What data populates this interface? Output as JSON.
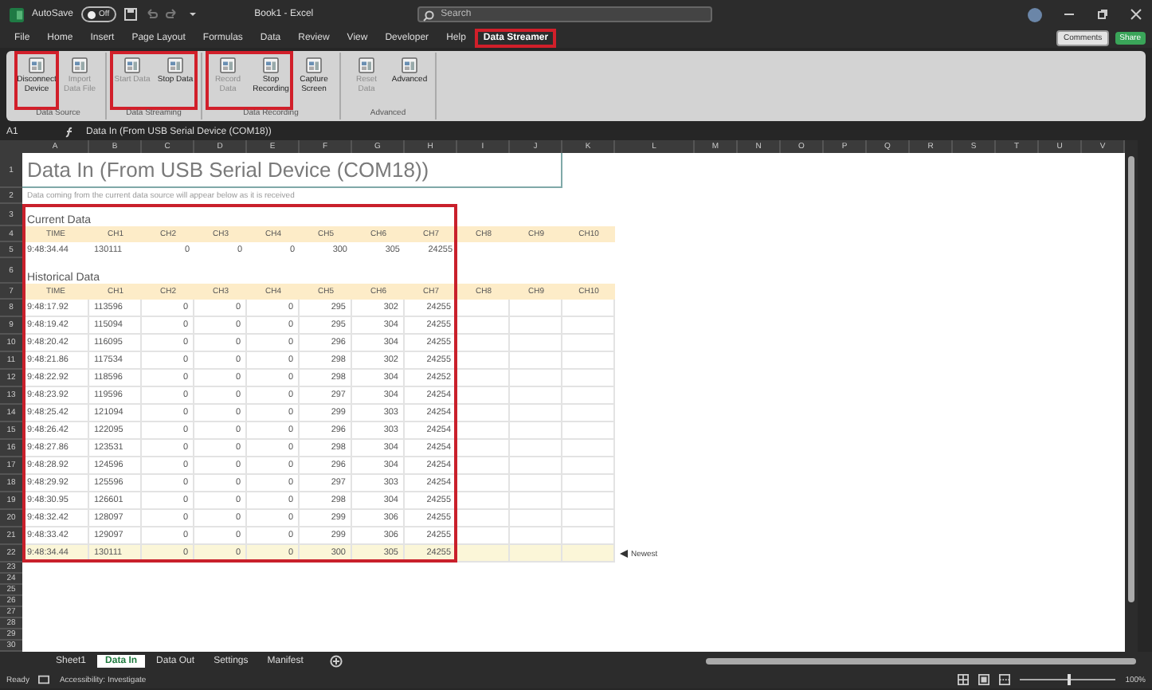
{
  "title_bar": {
    "autosave_label": "AutoSave",
    "autosave_on": false,
    "autosave_state": "Off",
    "document_title": "Book1 - Excel",
    "search": {
      "placeholder": "Search"
    }
  },
  "menu_tabs": [
    {
      "label": "File",
      "selected": false,
      "highlighted": false
    },
    {
      "label": "Home",
      "selected": false,
      "highlighted": false
    },
    {
      "label": "Insert",
      "selected": false,
      "highlighted": false
    },
    {
      "label": "Page Layout",
      "selected": false,
      "highlighted": false
    },
    {
      "label": "Formulas",
      "selected": false,
      "highlighted": false
    },
    {
      "label": "Data",
      "selected": false,
      "highlighted": false
    },
    {
      "label": "Review",
      "selected": false,
      "highlighted": false
    },
    {
      "label": "View",
      "selected": false,
      "highlighted": false
    },
    {
      "label": "Developer",
      "selected": false,
      "highlighted": false
    },
    {
      "label": "Help",
      "selected": false,
      "highlighted": false
    },
    {
      "label": "Data Streamer",
      "selected": true,
      "highlighted": true
    }
  ],
  "comments_button": "Comments",
  "share_button": "Share",
  "ribbon_groups": [
    {
      "label": "Data Source",
      "buttons": [
        {
          "label": "Disconnect Device",
          "disabled": false,
          "highlighted": true
        },
        {
          "label": "Import Data File",
          "disabled": true,
          "highlighted": false
        }
      ]
    },
    {
      "label": "Data Streaming",
      "buttons": [
        {
          "label": "Start Data",
          "disabled": true,
          "highlighted": true
        },
        {
          "label": "Stop Data",
          "disabled": false,
          "highlighted": true
        }
      ]
    },
    {
      "label": "Data Recording",
      "buttons": [
        {
          "label": "Record Data",
          "disabled": true,
          "highlighted": true
        },
        {
          "label": "Stop Recording",
          "disabled": false,
          "highlighted": true
        },
        {
          "label": "Capture Screen",
          "disabled": false,
          "highlighted": false
        }
      ]
    },
    {
      "label": "Advanced",
      "buttons": [
        {
          "label": "Reset Data",
          "disabled": true,
          "highlighted": false
        },
        {
          "label": "Advanced",
          "disabled": false,
          "highlighted": false
        }
      ]
    }
  ],
  "formula_bar": {
    "cell": "A1",
    "value": "Data In (From USB Serial Device (COM18))"
  },
  "columns": [
    "A",
    "B",
    "C",
    "D",
    "E",
    "F",
    "G",
    "H",
    "I",
    "J",
    "K",
    "L",
    "M",
    "N",
    "O",
    "P",
    "Q",
    "R",
    "S",
    "T",
    "U",
    "V"
  ],
  "row_numbers": [
    "1",
    "2",
    "3",
    "4",
    "5",
    "6",
    "7",
    "8",
    "9",
    "10",
    "11",
    "12",
    "13",
    "14",
    "15",
    "16",
    "17",
    "18",
    "19",
    "20",
    "21",
    "22",
    "23",
    "24",
    "25",
    "26",
    "27",
    "28",
    "29",
    "30"
  ],
  "sheet": {
    "title": "Data In (From USB Serial Device (COM18))",
    "subtitle": "Data coming from the current data source will appear below as it is received",
    "highlighted": true,
    "current_label": "Current Data",
    "current_headers": [
      "TIME",
      "CH1",
      "CH2",
      "CH3",
      "CH4",
      "CH5",
      "CH6",
      "CH7",
      "CH8",
      "CH9",
      "CH10"
    ],
    "current_row": [
      "9:48:34.44",
      "130111",
      "0",
      "0",
      "0",
      "300",
      "305",
      "24255"
    ],
    "historical_label": "Historical Data",
    "historical_headers": [
      "TIME",
      "CH1",
      "CH2",
      "CH3",
      "CH4",
      "CH5",
      "CH6",
      "CH7",
      "CH8",
      "CH9",
      "CH10"
    ],
    "historical_rows": [
      {
        "values": [
          "9:48:17.92",
          "113596",
          "0",
          "0",
          "0",
          "295",
          "302",
          "24255"
        ],
        "newest": false
      },
      {
        "values": [
          "9:48:19.42",
          "115094",
          "0",
          "0",
          "0",
          "295",
          "304",
          "24255"
        ],
        "newest": false
      },
      {
        "values": [
          "9:48:20.42",
          "116095",
          "0",
          "0",
          "0",
          "296",
          "304",
          "24255"
        ],
        "newest": false
      },
      {
        "values": [
          "9:48:21.86",
          "117534",
          "0",
          "0",
          "0",
          "298",
          "302",
          "24255"
        ],
        "newest": false
      },
      {
        "values": [
          "9:48:22.92",
          "118596",
          "0",
          "0",
          "0",
          "298",
          "304",
          "24252"
        ],
        "newest": false
      },
      {
        "values": [
          "9:48:23.92",
          "119596",
          "0",
          "0",
          "0",
          "297",
          "304",
          "24254"
        ],
        "newest": false
      },
      {
        "values": [
          "9:48:25.42",
          "121094",
          "0",
          "0",
          "0",
          "299",
          "303",
          "24254"
        ],
        "newest": false
      },
      {
        "values": [
          "9:48:26.42",
          "122095",
          "0",
          "0",
          "0",
          "296",
          "303",
          "24254"
        ],
        "newest": false
      },
      {
        "values": [
          "9:48:27.86",
          "123531",
          "0",
          "0",
          "0",
          "298",
          "304",
          "24254"
        ],
        "newest": false
      },
      {
        "values": [
          "9:48:28.92",
          "124596",
          "0",
          "0",
          "0",
          "296",
          "304",
          "24254"
        ],
        "newest": false
      },
      {
        "values": [
          "9:48:29.92",
          "125596",
          "0",
          "0",
          "0",
          "297",
          "303",
          "24254"
        ],
        "newest": false
      },
      {
        "values": [
          "9:48:30.95",
          "126601",
          "0",
          "0",
          "0",
          "298",
          "304",
          "24255"
        ],
        "newest": false
      },
      {
        "values": [
          "9:48:32.42",
          "128097",
          "0",
          "0",
          "0",
          "299",
          "306",
          "24255"
        ],
        "newest": false
      },
      {
        "values": [
          "9:48:33.42",
          "129097",
          "0",
          "0",
          "0",
          "299",
          "306",
          "24255"
        ],
        "newest": false
      },
      {
        "values": [
          "9:48:34.44",
          "130111",
          "0",
          "0",
          "0",
          "300",
          "305",
          "24255"
        ],
        "newest": true
      }
    ],
    "newest_marker": "Newest"
  },
  "sheet_tabs": [
    {
      "label": "Sheet1",
      "selected": false
    },
    {
      "label": "Data In",
      "selected": true
    },
    {
      "label": "Data Out",
      "selected": false
    },
    {
      "label": "Settings",
      "selected": false
    },
    {
      "label": "Manifest",
      "selected": false
    }
  ],
  "status_bar": {
    "ready": "Ready",
    "accessibility": "Accessibility: Investigate",
    "zoom": "100%",
    "level": 0.5
  }
}
